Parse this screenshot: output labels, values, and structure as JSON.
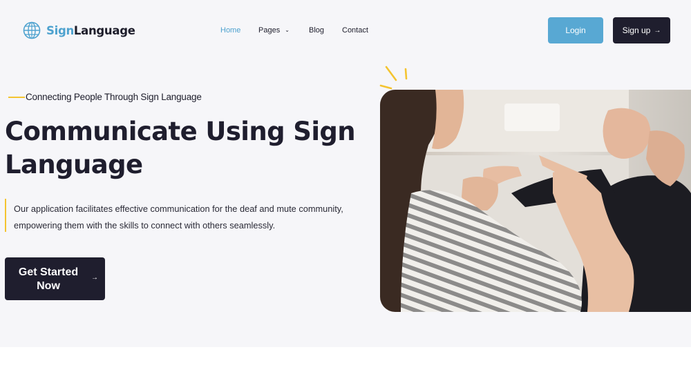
{
  "brand": {
    "name_accent": "Sign",
    "name_rest": "Language",
    "accent_color": "#4ea2cf",
    "logo_icon": "globe-icon"
  },
  "nav": {
    "items": [
      {
        "label": "Home",
        "active": true
      },
      {
        "label": "Pages",
        "has_dropdown": true,
        "icon": "chevron-down-icon"
      },
      {
        "label": "Blog"
      },
      {
        "label": "Contact"
      }
    ]
  },
  "header_actions": {
    "login_label": "Login",
    "signup_label": "Sign up",
    "signup_icon": "arrow-right-icon"
  },
  "hero": {
    "tagline": "Connecting People Through Sign Language",
    "headline": "Communicate Using Sign Language",
    "description": "Our application facilitates effective communication for the deaf and mute community, empowering them with the skills to connect with others seamlessly.",
    "cta_label": "Get Started Now",
    "cta_icon": "arrow-right-icon",
    "image_subject": "two people communicating with sign language"
  },
  "colors": {
    "dark": "#1f1e2e",
    "login_blue": "#58a8d3",
    "highlight_yellow": "#f4c430",
    "hero_background": "#f6f6f9"
  }
}
